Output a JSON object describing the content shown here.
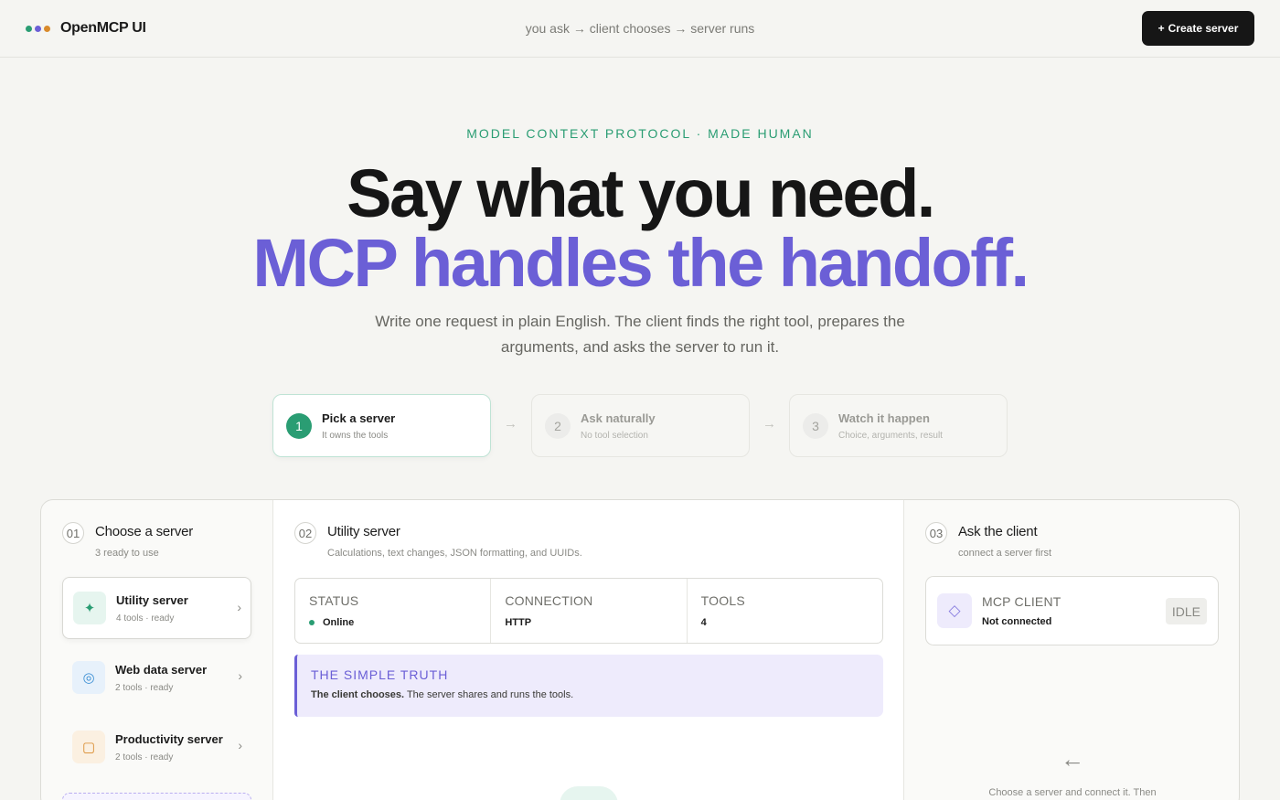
{
  "app": {
    "name": "OpenMCP UI",
    "tagline": "you ask → client chooses → server runs",
    "create_button": "Create server",
    "dot_colors": [
      "#2a9d73",
      "#6b5fd6",
      "#d98a2b"
    ]
  },
  "hero": {
    "eyebrow": "MODEL CONTEXT PROTOCOL · MADE HUMAN",
    "headline_1": "Say what you need.",
    "headline_2": "MCP handles the handoff.",
    "subtitle": "Write one request in plain English. The client finds the right tool, prepares the arguments, and asks the server to run it."
  },
  "steps": [
    {
      "num": "1",
      "title": "Pick a server",
      "desc": "It owns the tools",
      "active": true
    },
    {
      "num": "2",
      "title": "Ask naturally",
      "desc": "No tool selection",
      "active": false
    },
    {
      "num": "3",
      "title": "Watch it happen",
      "desc": "Choice, arguments, result",
      "active": false
    }
  ],
  "choose": {
    "num": "01",
    "title": "Choose a server",
    "subtitle": "3 ready to use",
    "servers": [
      {
        "name": "Utility server",
        "meta": "4 tools · ready",
        "icon": "sparkle-icon"
      },
      {
        "name": "Web data server",
        "meta": "2 tools · ready",
        "icon": "target-icon"
      },
      {
        "name": "Productivity server",
        "meta": "2 tools · ready",
        "icon": "square-icon"
      }
    ]
  },
  "detail": {
    "num": "02",
    "title": "Utility server",
    "subtitle": "Calculations, text changes, JSON formatting, and UUIDs.",
    "status_label": "STATUS",
    "status_value": "Online",
    "connection_label": "CONNECTION",
    "connection_value": "HTTP",
    "tools_label": "TOOLS",
    "tools_value": "4",
    "truth_label": "THE SIMPLE TRUTH",
    "truth_strong": "The client chooses.",
    "truth_rest": " The server shares and runs the tools."
  },
  "ask": {
    "num": "03",
    "title": "Ask the client",
    "subtitle": "connect a server first",
    "client_label": "MCP CLIENT",
    "client_status": "Not connected",
    "badge": "IDLE",
    "hint": "Choose a server and connect it. Then"
  }
}
